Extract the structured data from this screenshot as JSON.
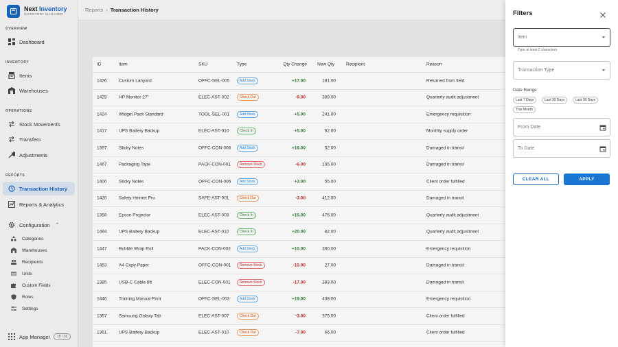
{
  "brand": {
    "name_part1": "Next",
    "name_part2": "Inventory",
    "subtitle": "INVENTORY MANAGER"
  },
  "sidebar": {
    "overview_label": "OVERVIEW",
    "dashboard": "Dashboard",
    "inventory_label": "INVENTORY",
    "items": "Items",
    "warehouses": "Warehouses",
    "operations_label": "OPERATIONS",
    "stock_movements": "Stock Movements",
    "transfers": "Transfers",
    "adjustments": "Adjustments",
    "reports_label": "REPORTS",
    "transaction_history": "Transaction History",
    "reports_analytics": "Reports & Analytics",
    "configuration": "Configuration",
    "config_items": [
      "Categories",
      "Warehouses",
      "Recipients",
      "Units",
      "Custom Fields",
      "Roles",
      "Settings"
    ],
    "app_manager": "App Manager",
    "app_manager_badge": "10 / 10"
  },
  "header": {
    "crumb_parent": "Reports",
    "separator": "›",
    "crumb_current": "Transaction History"
  },
  "table": {
    "columns": [
      "ID",
      "Item",
      "SKU",
      "Type",
      "Qty Change",
      "New Qty",
      "Recipient",
      "Reason"
    ],
    "rows": [
      {
        "id": "1426",
        "item": "Custom Lanyard",
        "sku": "OFFC-SEL-005",
        "type": "Add Stock",
        "type_kind": "add",
        "qty": "+17.00",
        "new_qty": "181.00",
        "recipient": "",
        "reason": "Returned from field"
      },
      {
        "id": "1429",
        "item": "HP Monitor 27\"",
        "sku": "ELEC-AST-002",
        "type": "Check Out",
        "type_kind": "out",
        "qty": "-9.00",
        "new_qty": "389.00",
        "recipient": "",
        "reason": "Quarterly audit adjustment"
      },
      {
        "id": "1424",
        "item": "Widget Pack Standard",
        "sku": "TOOL-SEL-001",
        "type": "Add Stock",
        "type_kind": "add",
        "qty": "+5.00",
        "new_qty": "241.00",
        "recipient": "",
        "reason": "Emergency requisition"
      },
      {
        "id": "1417",
        "item": "UPS Battery Backup",
        "sku": "ELEC-AST-010",
        "type": "Check In",
        "type_kind": "in",
        "qty": "+5.00",
        "new_qty": "62.00",
        "recipient": "",
        "reason": "Monthly supply order"
      },
      {
        "id": "1397",
        "item": "Sticky Notes",
        "sku": "OFFC-CON-006",
        "type": "Add Stock",
        "type_kind": "add",
        "qty": "+16.00",
        "new_qty": "52.00",
        "recipient": "",
        "reason": "Damaged in transit"
      },
      {
        "id": "1467",
        "item": "Packaging Tape",
        "sku": "PACK-CON-001",
        "type": "Remove Stock",
        "type_kind": "remove",
        "qty": "-6.00",
        "new_qty": "105.00",
        "recipient": "",
        "reason": "Damaged in transit"
      },
      {
        "id": "1400",
        "item": "Sticky Notes",
        "sku": "OFFC-CON-006",
        "type": "Add Stock",
        "type_kind": "add",
        "qty": "+3.00",
        "new_qty": "55.00",
        "recipient": "",
        "reason": "Client order fulfilled"
      },
      {
        "id": "1420",
        "item": "Safety Helmet Pro",
        "sku": "SAFE-AST-001",
        "type": "Check Out",
        "type_kind": "out",
        "qty": "-3.00",
        "new_qty": "412.00",
        "recipient": "",
        "reason": "Damaged in transit"
      },
      {
        "id": "1358",
        "item": "Epson Projector",
        "sku": "ELEC-AST-003",
        "type": "Check In",
        "type_kind": "in",
        "qty": "+15.00",
        "new_qty": "476.00",
        "recipient": "",
        "reason": "Quarterly audit adjustment"
      },
      {
        "id": "1494",
        "item": "UPS Battery Backup",
        "sku": "ELEC-AST-010",
        "type": "Check In",
        "type_kind": "in",
        "qty": "+20.00",
        "new_qty": "82.00",
        "recipient": "",
        "reason": "Quarterly audit adjustment"
      },
      {
        "id": "1447",
        "item": "Bubble Wrap Roll",
        "sku": "PACK-CON-002",
        "type": "Add Stock",
        "type_kind": "add",
        "qty": "+10.00",
        "new_qty": "390.00",
        "recipient": "",
        "reason": "Emergency requisition"
      },
      {
        "id": "1453",
        "item": "A4 Copy Paper",
        "sku": "OFFC-CON-001",
        "type": "Remove Stock",
        "type_kind": "remove",
        "qty": "-15.00",
        "new_qty": "27.00",
        "recipient": "",
        "reason": "Damaged in transit"
      },
      {
        "id": "1385",
        "item": "USB-C Cable 6ft",
        "sku": "ELEC-CON-001",
        "type": "Remove Stock",
        "type_kind": "remove",
        "qty": "-17.00",
        "new_qty": "383.00",
        "recipient": "",
        "reason": "Damaged in transit"
      },
      {
        "id": "1446",
        "item": "Training Manual Print",
        "sku": "OFFC-SEL-003",
        "type": "Add Stock",
        "type_kind": "add",
        "qty": "+19.00",
        "new_qty": "438.00",
        "recipient": "",
        "reason": "Emergency requisition"
      },
      {
        "id": "1367",
        "item": "Samsung Galaxy Tab",
        "sku": "ELEC-AST-007",
        "type": "Check Out",
        "type_kind": "out",
        "qty": "-3.00",
        "new_qty": "375.00",
        "recipient": "",
        "reason": "Client order fulfilled"
      },
      {
        "id": "1361",
        "item": "UPS Battery Backup",
        "sku": "ELEC-AST-010",
        "type": "Check Out",
        "type_kind": "out",
        "qty": "-7.00",
        "new_qty": "66.00",
        "recipient": "",
        "reason": "Client order fulfilled"
      }
    ]
  },
  "filters": {
    "title": "Filters",
    "item_placeholder": "Item",
    "item_helper": "Type at least 2 characters",
    "transaction_type_placeholder": "Transaction Type",
    "date_range_label": "Date Range",
    "quick_ranges": [
      "Last 7 Days",
      "Last 30 Days",
      "Last 90 Days",
      "This Month"
    ],
    "from_date_placeholder": "From Date",
    "to_date_placeholder": "To Date",
    "clear_all": "CLEAR ALL",
    "apply": "APPLY"
  },
  "colors": {
    "accent": "#1565c0",
    "positive": "#2e7d32",
    "negative": "#c62828"
  }
}
